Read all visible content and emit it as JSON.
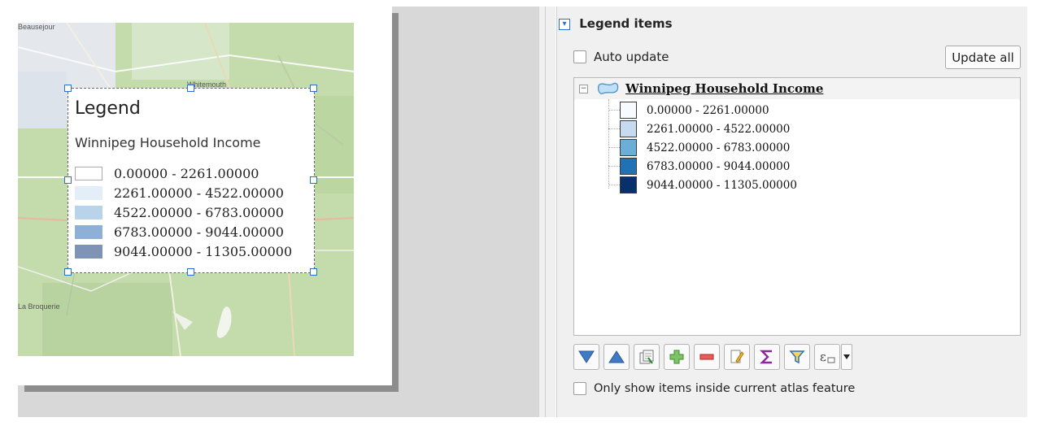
{
  "map": {
    "place_labels": [
      "Beausejour",
      "Whitemouth",
      "La Broquerie"
    ]
  },
  "legend_preview": {
    "title": "Legend",
    "layer_name": "Winnipeg Household Income",
    "items": [
      {
        "label": "0.00000 - 2261.00000",
        "color": "#ffffff"
      },
      {
        "label": "2261.00000 - 4522.00000",
        "color": "#e4eef8"
      },
      {
        "label": "4522.00000 - 6783.00000",
        "color": "#b8d3ea"
      },
      {
        "label": "6783.00000 - 9044.00000",
        "color": "#8fb0d6"
      },
      {
        "label": "9044.00000 - 11305.00000",
        "color": "#7f93b5"
      }
    ]
  },
  "panel": {
    "group_title": "Legend items",
    "auto_update_label": "Auto update",
    "auto_update_checked": false,
    "update_all_label": "Update all",
    "tree": {
      "layer_name": "Winnipeg Household Income",
      "classes": [
        {
          "label": "0.00000 - 2261.00000",
          "color": "#f7fbff"
        },
        {
          "label": "2261.00000 - 4522.00000",
          "color": "#c6dbef"
        },
        {
          "label": "4522.00000 - 6783.00000",
          "color": "#6baed6"
        },
        {
          "label": "6783.00000 - 9044.00000",
          "color": "#2171b5"
        },
        {
          "label": "9044.00000 - 11305.00000",
          "color": "#08306b"
        }
      ]
    },
    "toolbar_icons": [
      "move-down-icon",
      "move-up-icon",
      "edit-group-icon",
      "add-item-icon",
      "remove-item-icon",
      "edit-item-icon",
      "count-features-icon",
      "filter-legend-icon",
      "expression-filter-icon",
      "dropdown-arrow-icon"
    ],
    "atlas_only_label": "Only show items inside current atlas feature",
    "atlas_only_checked": false
  }
}
